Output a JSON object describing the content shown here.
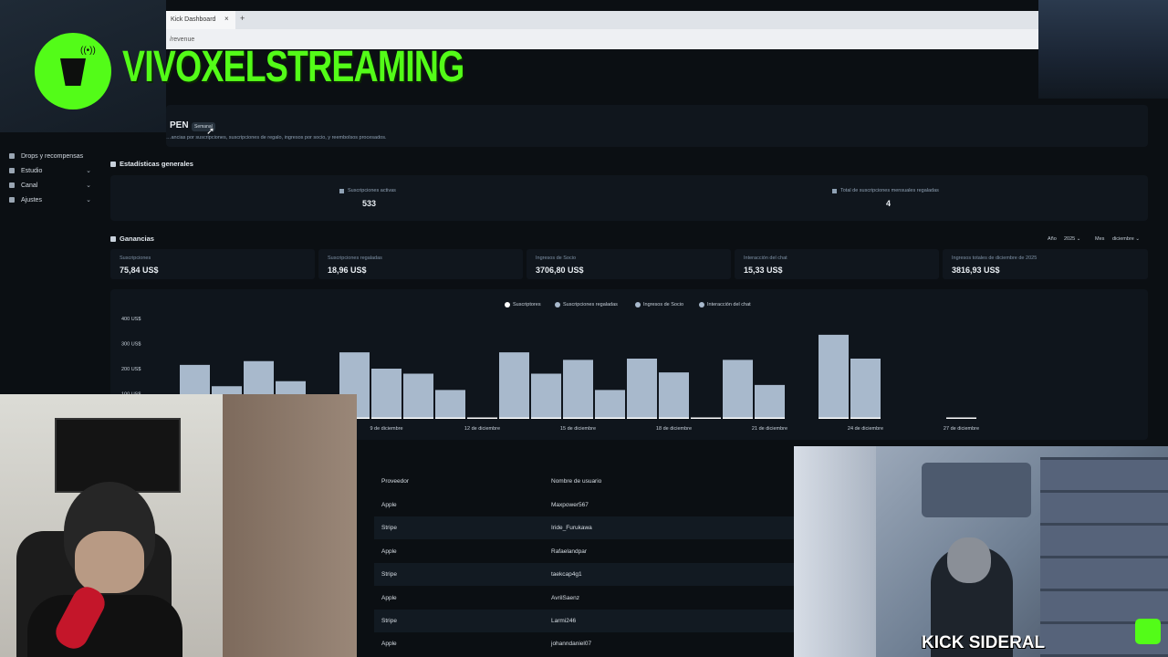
{
  "browser": {
    "tab_title": "Kick Dashboard",
    "tab_close": "×",
    "tab_new": "+",
    "url_fragment": "/revenue"
  },
  "overlay": {
    "brand_name": "VIVOXELSTREAMING",
    "brand_color": "#53fc18",
    "streamer_tag": "KICK SIDERAL"
  },
  "sidebar": {
    "items": [
      {
        "label": "Drops y recompensas",
        "icon": "gift-icon",
        "has_chevron": false
      },
      {
        "label": "Estudio",
        "icon": "studio-icon",
        "has_chevron": true
      },
      {
        "label": "Canal",
        "icon": "channel-icon",
        "has_chevron": true
      },
      {
        "label": "Ajustes",
        "icon": "gear-icon",
        "has_chevron": true
      }
    ],
    "chevron": "⌄"
  },
  "header": {
    "currency": "PEN",
    "badge": "Semanal",
    "description": "…ancias por suscripciones, suscripciones de regalo, ingresos por socio, y reembolsos procesados."
  },
  "general_stats": {
    "title": "Estadísticas generales",
    "active_subs_label": "Suscripciones activas",
    "active_subs_value": "533",
    "gifted_monthly_label": "Total de suscripciones mensuales regaladas",
    "gifted_monthly_value": "4"
  },
  "earnings": {
    "title": "Ganancias",
    "year_label": "Año",
    "year_value": "2025",
    "month_label": "Mes",
    "month_value": "diciembre",
    "cards": [
      {
        "label": "Suscripciones",
        "value": "75,84 US$"
      },
      {
        "label": "Suscripciones regaladas",
        "value": "18,96 US$"
      },
      {
        "label": "Ingresos de Socio",
        "value": "3706,80 US$"
      },
      {
        "label": "Interacción del chat",
        "value": "15,33 US$"
      },
      {
        "label": "Ingresos totales de diciembre de 2025",
        "value": "3816,93 US$"
      }
    ]
  },
  "chart_data": {
    "type": "bar",
    "legend": [
      {
        "name": "Suscriptores",
        "color": "#ffffff"
      },
      {
        "name": "Suscripciones regaladas",
        "color": "#a8b9cc"
      },
      {
        "name": "Ingresos de Socio",
        "color": "#a8b9cc"
      },
      {
        "name": "Interacción del chat",
        "color": "#a8b9cc"
      }
    ],
    "y_ticks": [
      "400 US$",
      "300 US$",
      "200 US$",
      "100 US$"
    ],
    "ylim": [
      0,
      420
    ],
    "x_tick_labels": [
      "…mbre",
      "9 de diciembre",
      "12 de diciembre",
      "15 de diciembre",
      "18 de diciembre",
      "21 de diciembre",
      "24 de diciembre",
      "27 de diciembre"
    ],
    "x_tick_days": [
      6,
      9,
      12,
      15,
      18,
      21,
      24,
      27
    ],
    "days": [
      3,
      4,
      5,
      6,
      8,
      9,
      10,
      11,
      12,
      13,
      14,
      15,
      16,
      17,
      18,
      19,
      20,
      21,
      23,
      24,
      27
    ],
    "values": [
      215,
      130,
      230,
      150,
      265,
      200,
      180,
      115,
      2,
      265,
      180,
      235,
      115,
      240,
      185,
      3,
      235,
      135,
      335,
      240,
      4
    ],
    "bar_color": "#a8b9cc"
  },
  "table": {
    "columns": [
      "Proveedor",
      "Nombre de usuario"
    ],
    "rows": [
      {
        "provider": "Apple",
        "username": "Maxpower567"
      },
      {
        "provider": "Stripe",
        "username": "Iride_Furukawa"
      },
      {
        "provider": "Apple",
        "username": "Rafaelandpar"
      },
      {
        "provider": "Stripe",
        "username": "taekcap4g1"
      },
      {
        "provider": "Apple",
        "username": "AvrilSaenz"
      },
      {
        "provider": "Stripe",
        "username": "Larmi246"
      },
      {
        "provider": "Apple",
        "username": "johanndaniel07"
      }
    ]
  }
}
